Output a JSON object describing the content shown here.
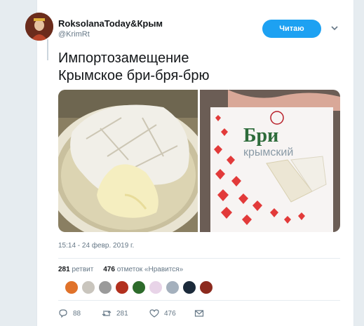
{
  "user": {
    "name": "RoksolanaToday&Крым",
    "handle": "@KrimRt"
  },
  "follow_label": "Читаю",
  "tweet": {
    "line1": "Импортозамещение",
    "line2": "Крымское бри-бря-брю"
  },
  "photo_text": {
    "brand": "Бри",
    "subtitle": "крымский"
  },
  "timestamp": "15:14 - 24 февр. 2019 г.",
  "stats": {
    "retweets_count": "281",
    "retweets_label": "ретвит",
    "likes_count": "476",
    "likes_label": "отметок «Нравится»"
  },
  "likers": [
    {
      "color": "#e0722a"
    },
    {
      "color": "#c9c5bd"
    },
    {
      "color": "#9a9a9a"
    },
    {
      "color": "#b2301e"
    },
    {
      "color": "#2d6b2b"
    },
    {
      "color": "#e8d4e8"
    },
    {
      "color": "#a4b0bd"
    },
    {
      "color": "#1b2a3a"
    },
    {
      "color": "#8c2a1e"
    }
  ],
  "actions": {
    "replies": "88",
    "retweets": "281",
    "likes": "476"
  },
  "colors": {
    "accent": "#1da1f2",
    "muted": "#657786",
    "text": "#14171a"
  }
}
